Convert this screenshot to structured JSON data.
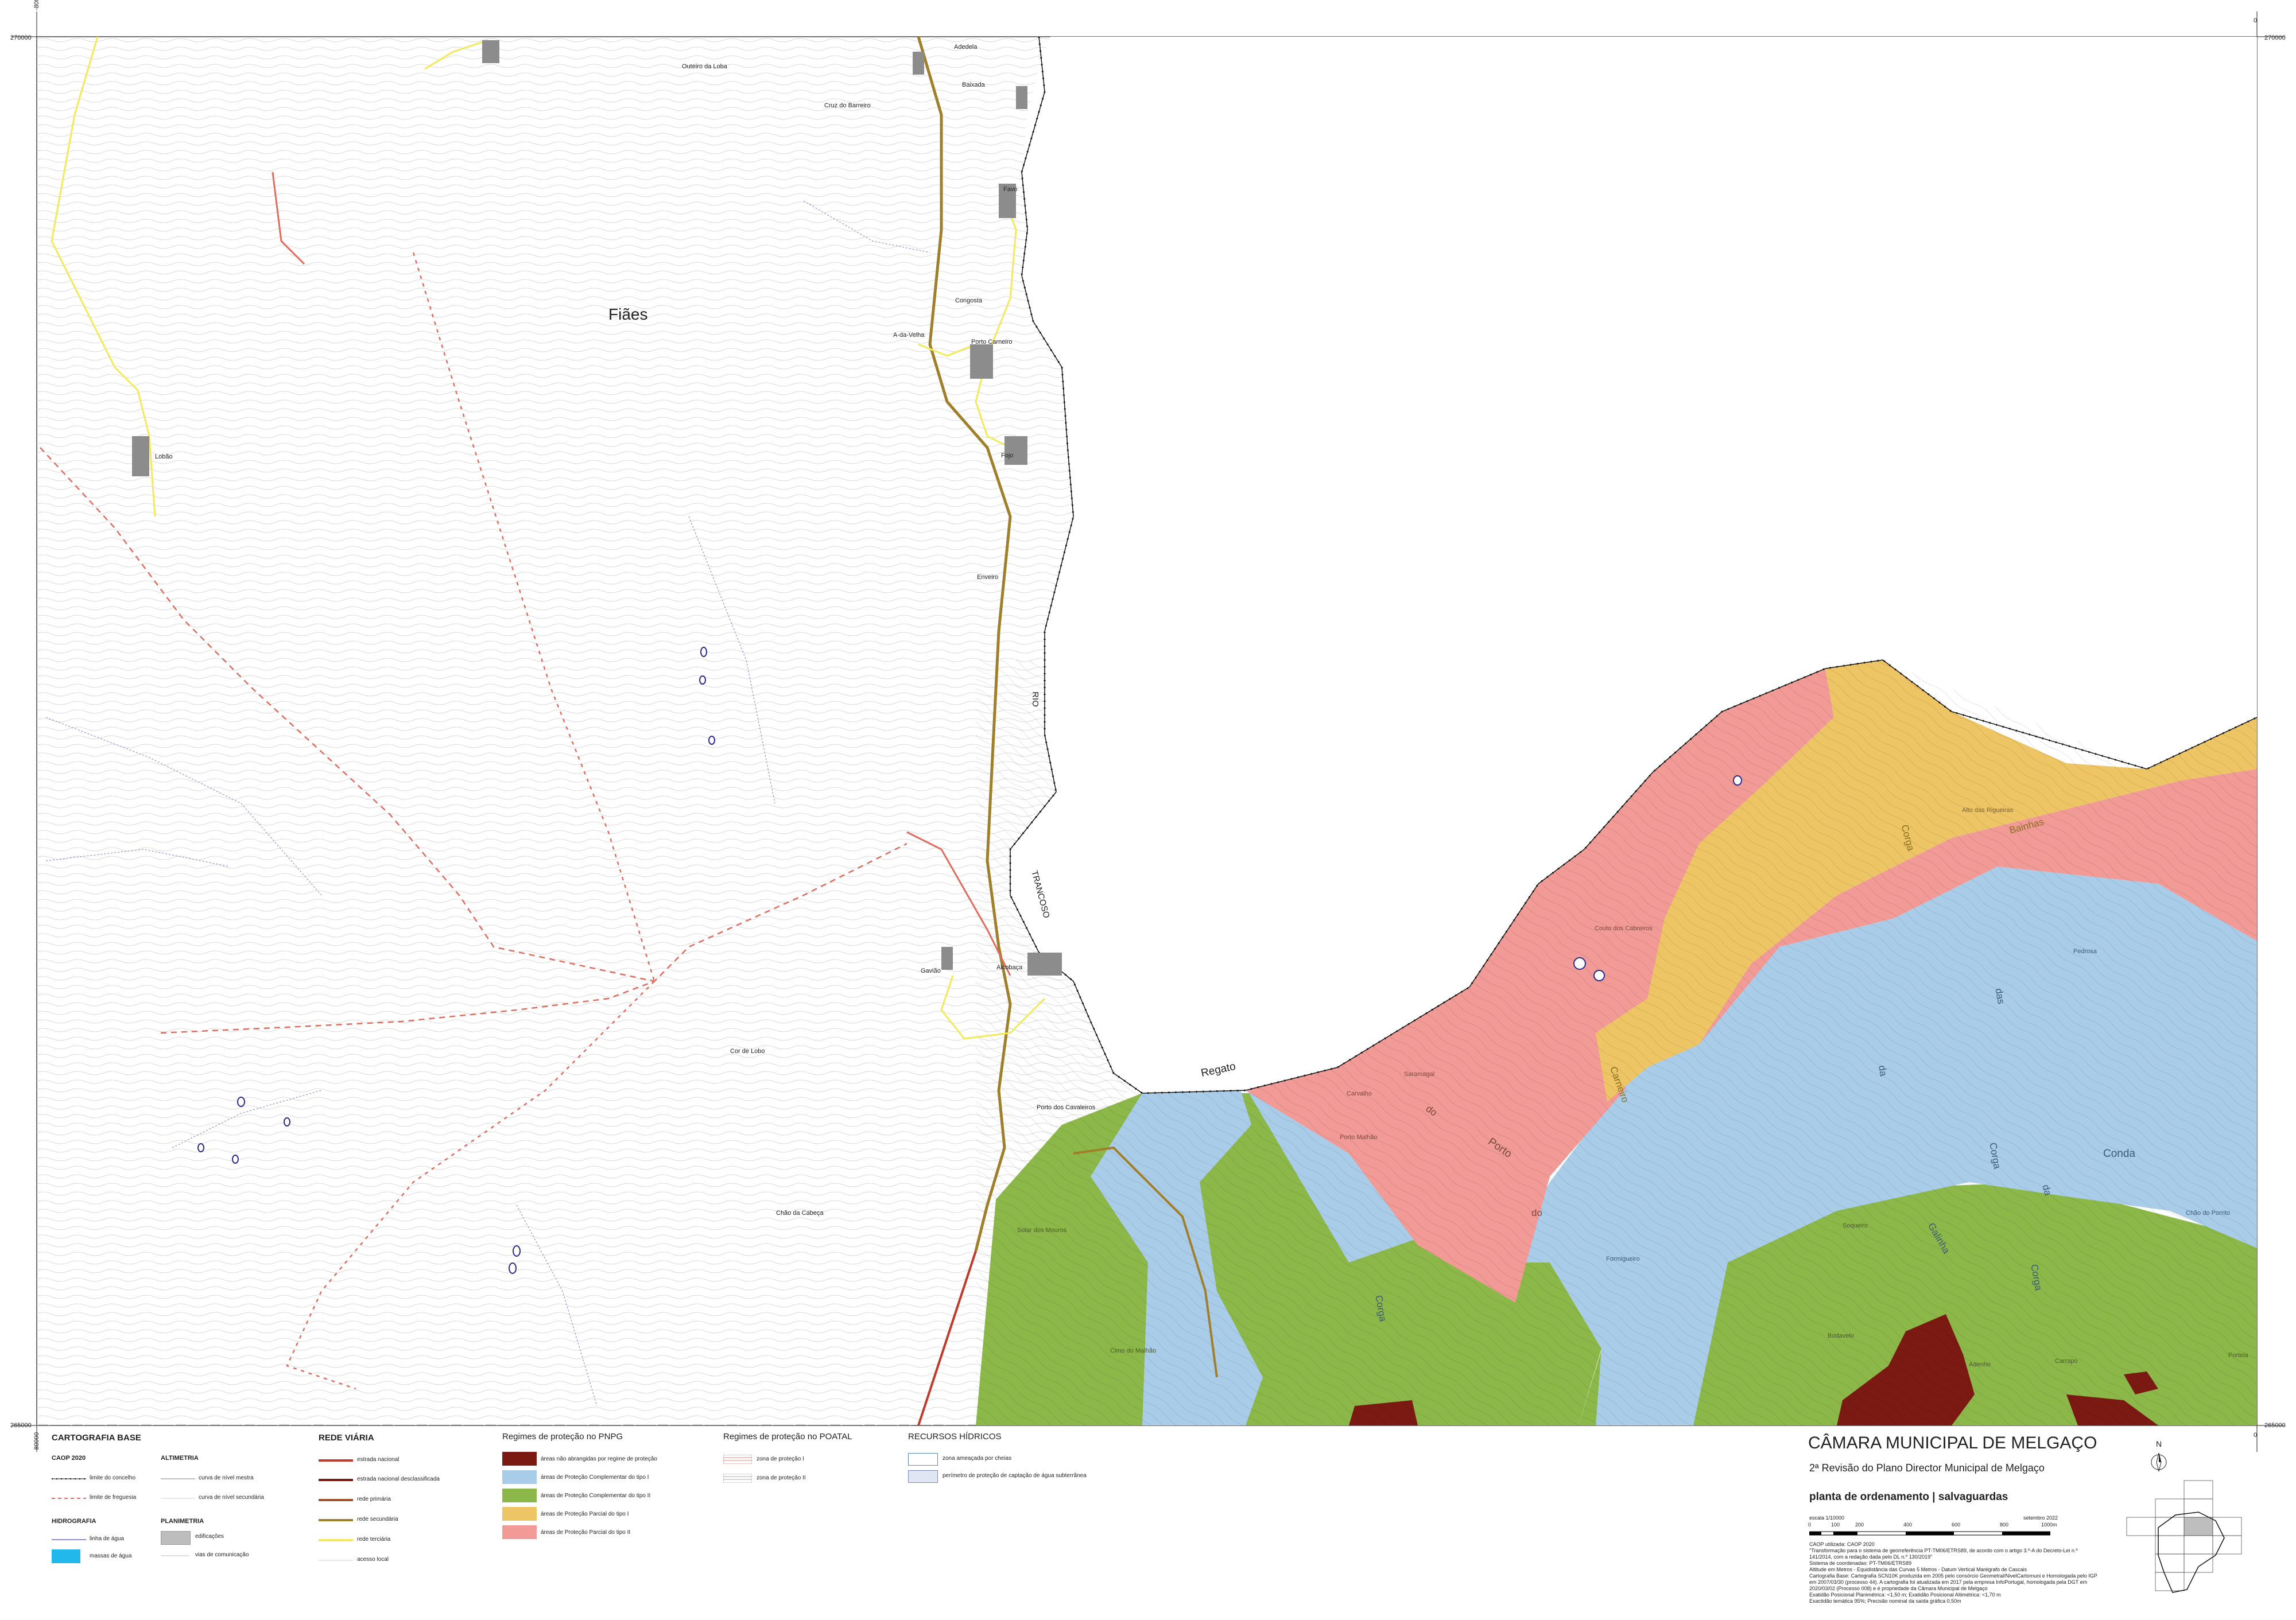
{
  "map": {
    "coords": {
      "top_left": "270000",
      "top_right": "270000",
      "bottom_left": "265000",
      "bottom_right": "265000",
      "left_top": "-80000",
      "left_bottom": "-80000",
      "right_top": "0",
      "right_bottom": "0"
    },
    "places": [
      {
        "id": "fiaes",
        "text": "Fiães",
        "big": true
      },
      {
        "id": "adedela",
        "text": "Adedela"
      },
      {
        "id": "outeiro",
        "text": "Outeiro da Loba"
      },
      {
        "id": "baixada",
        "text": "Baixada"
      },
      {
        "id": "cruz",
        "text": "Cruz do Barreiro"
      },
      {
        "id": "favo",
        "text": "Favo"
      },
      {
        "id": "congosta",
        "text": "Congosta"
      },
      {
        "id": "avelha",
        "text": "A-da-Velha"
      },
      {
        "id": "portocarneiro",
        "text": "Porto Carneiro"
      },
      {
        "id": "lobao",
        "text": "Lobão"
      },
      {
        "id": "fojo",
        "text": "Fojo"
      },
      {
        "id": "enveiro",
        "text": "Enveiro"
      },
      {
        "id": "rio",
        "text": "RIO"
      },
      {
        "id": "trancoso",
        "text": "TRANCOSO"
      },
      {
        "id": "gaviao",
        "text": "Gavião"
      },
      {
        "id": "alcobaca",
        "text": "Alcobaça"
      },
      {
        "id": "corlobo",
        "text": "Cor de Lobo"
      },
      {
        "id": "portocavaleiros",
        "text": "Porto dos Cavaleiros"
      },
      {
        "id": "chao",
        "text": "Chão da Cabeça"
      },
      {
        "id": "regato",
        "text": "Regato"
      },
      {
        "id": "corga1",
        "text": "Corga"
      },
      {
        "id": "bainhas",
        "text": "Bainhas"
      },
      {
        "id": "alto",
        "text": "Alto das Rigueiras"
      },
      {
        "id": "couto",
        "text": "Couto dos Cabreiros"
      },
      {
        "id": "carvalho",
        "text": "Carvalho"
      },
      {
        "id": "saramagal",
        "text": "Saramagal"
      },
      {
        "id": "do1",
        "text": "do"
      },
      {
        "id": "porto",
        "text": "Porto"
      },
      {
        "id": "portomalhao",
        "text": "Porto Malhão"
      },
      {
        "id": "do2",
        "text": "do"
      },
      {
        "id": "carneiro",
        "text": "Carneiro"
      },
      {
        "id": "das",
        "text": "das"
      },
      {
        "id": "da1",
        "text": "da"
      },
      {
        "id": "conda",
        "text": "Conda"
      },
      {
        "id": "corga2",
        "text": "Corga"
      },
      {
        "id": "da2",
        "text": "da"
      },
      {
        "id": "galinha",
        "text": "Galinha"
      },
      {
        "id": "corga3",
        "text": "Corga"
      },
      {
        "id": "corga4",
        "text": "Corga"
      },
      {
        "id": "pedrosa",
        "text": "Pedrosa"
      },
      {
        "id": "chaoporrito",
        "text": "Chão do Porrito"
      },
      {
        "id": "solar",
        "text": "Solar dos Mouros"
      },
      {
        "id": "formigueiro",
        "text": "Formigueiro"
      },
      {
        "id": "cimo",
        "text": "Cimo do Malhão"
      },
      {
        "id": "soqueiro",
        "text": "Soqueiro"
      },
      {
        "id": "bodavelo",
        "text": "Bodavelo"
      },
      {
        "id": "adenho",
        "text": "Adenho"
      },
      {
        "id": "portela",
        "text": "Portela"
      },
      {
        "id": "carrapo",
        "text": "Carrapo"
      }
    ]
  },
  "legend": {
    "cartografia": {
      "title": "CARTOGRAFIA BASE",
      "caop_title": "CAOP 2020",
      "caop": [
        "limite do concelho",
        "limite de freguesia"
      ],
      "altimetria_title": "ALTIMETRIA",
      "altimetria": [
        "curva de nível mestra",
        "curva de nível secundária"
      ],
      "hidrografia_title": "HIDROGRAFIA",
      "hidrografia": [
        "linha de água",
        "massas de água"
      ],
      "planimetria_title": "PLANIMETRIA",
      "planimetria": [
        "edificações",
        "vias de comunicação"
      ]
    },
    "rede_viaria": {
      "title": "REDE VIÁRIA",
      "items": [
        "estrada nacional",
        "estrada nacional desclassificada",
        "rede primária",
        "rede secundária",
        "rede terciária",
        "acesso local"
      ]
    },
    "pnpg": {
      "title": "Regimes de proteção no PNPG",
      "items": [
        {
          "label": "áreas não abrangidas por regime de proteção",
          "color": "#7a1a12"
        },
        {
          "label": "áreas de Proteção Complementar do tipo I",
          "color": "#a9cde9"
        },
        {
          "label": "áreas de Proteção Complementar do tipo II",
          "color": "#8cb84a"
        },
        {
          "label": "áreas de Proteção Parcial do tipo I",
          "color": "#eec565"
        },
        {
          "label": "áreas de Proteção Parcial do tipo II",
          "color": "#f19a96"
        }
      ]
    },
    "poatal": {
      "title": "Regimes de proteção no POATAL",
      "items": [
        "zona de proteção I",
        "zona de proteção II"
      ]
    },
    "hidricos": {
      "title": "RECURSOS HÍDRICOS",
      "items": [
        "zona ameaçada por cheias",
        "perímetro de proteção de captação de água subterrânea"
      ]
    }
  },
  "titleblock": {
    "title": "CÂMARA MUNICIPAL DE MELGAÇO",
    "subtitle": "2ª Revisão do Plano Director Municipal de Melgaço",
    "document": "planta de ordenamento | salvaguardas",
    "scale_label": "escala 1/10000",
    "date": "setembro 2022",
    "scale_ticks": [
      "0",
      "100",
      "200",
      "400",
      "600",
      "800",
      "1000m"
    ],
    "notes": [
      "CAOP utilizada: CAOP 2020",
      "\"Transformação para o sistema de georreferência PT-TM06/ETRS89, de acordo com o artigo 3.º-A do Decreto-Lei n.º",
      "141/2014, com a redação dada pelo DL n.º 130/2019\"",
      "Sistema de coordenadas: PT-TM06/ETRS89",
      "Altitude em Metros - Equidistância das Curvas 5 Metros - Datum Vertical Marégrafo de Cascais",
      "Cartografia Base: Cartografia SCN10K produzida em 2005 pelo consórcio Geometral/NivelCartomuni e Homologada pelo IGP",
      "em 2007/03/30 (processo 44). A cartografia foi atualizada em 2017 pela empresa InfoPortugal, homologada pela DGT em",
      "2020/03/02 (Processo 008) e é propriedade da Câmara Municipal de Melgaço",
      "Exatidão Posicional Planimétrica: <1,50 m; Exatidão Posicional Altimétrica: <1,70 m",
      "Exactidão temática 95%; Precisão nominal da saída gráfica 0,50m"
    ],
    "north": "N"
  }
}
